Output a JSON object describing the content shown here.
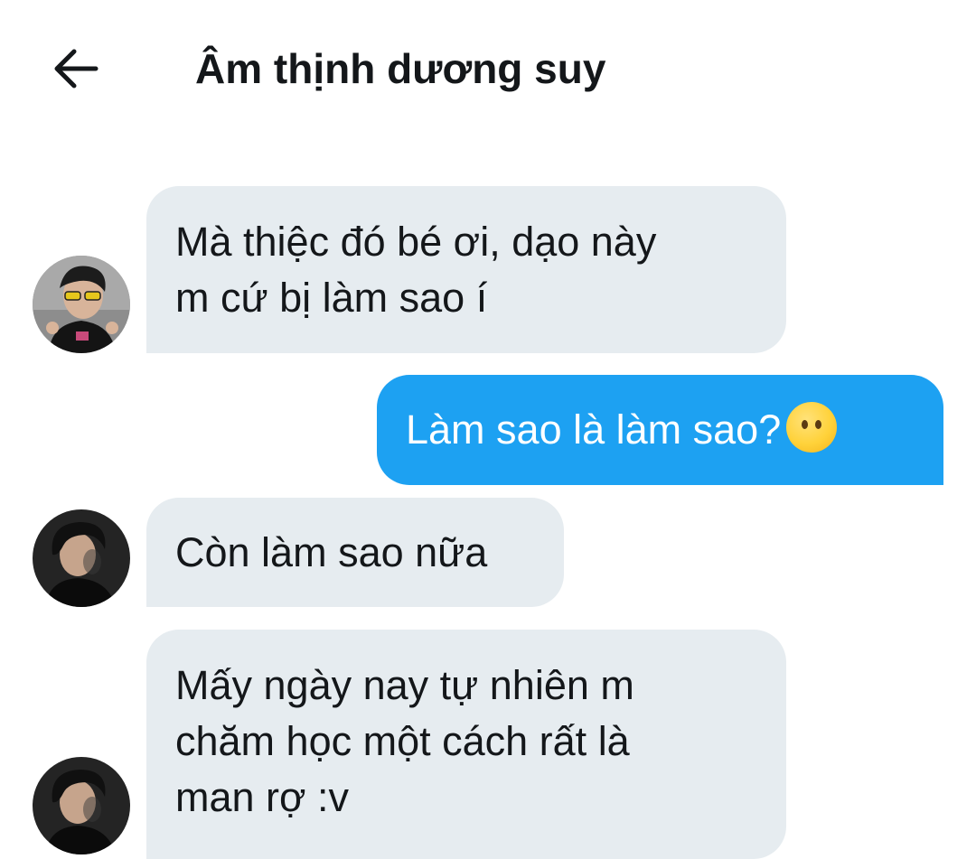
{
  "header": {
    "back_icon": "arrow-left-icon",
    "title": "Âm thịnh dương suy"
  },
  "colors": {
    "incoming_bubble": "#e6ecf0",
    "outgoing_bubble": "#1da1f2",
    "text": "#14171a"
  },
  "messages": [
    {
      "direction": "incoming",
      "text": "Mà thiệc đó bé ơi, dạo này\nm cứ bị làm sao í",
      "avatar": "avatar-1"
    },
    {
      "direction": "outgoing",
      "text": "Làm sao là làm sao?",
      "emoji": "face-without-mouth-emoji"
    },
    {
      "direction": "incoming",
      "text": "Còn làm sao nữa",
      "avatar": "avatar-2"
    },
    {
      "direction": "incoming",
      "text": "Mấy ngày nay tự nhiên m\nchăm học một cách rất là\nman rợ :v",
      "avatar": "avatar-2"
    }
  ]
}
